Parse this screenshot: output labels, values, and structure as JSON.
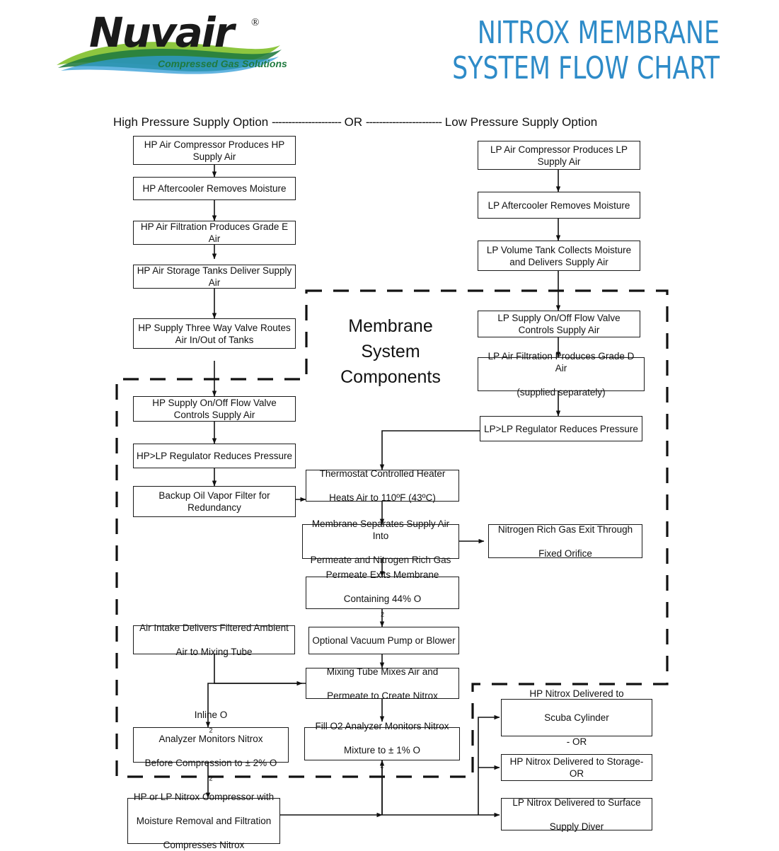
{
  "logo": {
    "brand": "Nuvair",
    "registered": "®",
    "tagline": "Compressed Gas Solutions",
    "brand_color": "#1a1a1a",
    "tagline_color": "#1f7a3f"
  },
  "title": {
    "line1": "NITROX MEMBRANE",
    "line2": "SYSTEM FLOW CHART",
    "color": "#2E8BC8"
  },
  "options_header": {
    "left": "High Pressure Supply Option",
    "dash_left": "---------------------",
    "or": "OR",
    "dash_right": "-----------------------",
    "right": "Low Pressure Supply Option"
  },
  "membrane_group": {
    "label_line1": "Membrane",
    "label_line2": "System",
    "label_line3": "Components"
  },
  "nodes": {
    "hp1": "HP Air Compressor Produces HP Supply Air",
    "hp2": "HP Aftercooler Removes Moisture",
    "hp3": "HP Air Filtration Produces Grade E Air",
    "hp4": "HP Air Storage Tanks Deliver Supply Air",
    "hp5": "HP Supply Three Way Valve Routes Air In/Out of Tanks",
    "hp6": "HP Supply On/Off Flow Valve Controls Supply Air",
    "hp7": "HP>LP Regulator Reduces Pressure",
    "hp8": "Backup Oil Vapor Filter for Redundancy",
    "lp1": "LP Air Compressor Produces LP Supply Air",
    "lp2": "LP Aftercooler Removes Moisture",
    "lp3": "LP Volume Tank Collects Moisture and Delivers Supply Air",
    "lp4": "LP Supply On/Off Flow Valve Controls Supply Air",
    "lp5_line1": "LP Air Filtration Produces Grade D Air",
    "lp5_line2": "(supplied separately)",
    "lp6": "LP>LP Regulator Reduces Pressure",
    "heater_line1": "Thermostat Controlled Heater",
    "heater_line2": "Heats Air to 110ºF (43ºC)",
    "membrane_line1": "Membrane Separates Supply Air Into",
    "membrane_line2": "Permeate and Nitrogen Rich Gas",
    "nitrogen_exit_line1": "Nitrogen Rich Gas Exit Through",
    "nitrogen_exit_line2": "Fixed Orifice",
    "permeate_line1": "Permeate Exits Membrane",
    "permeate_line2_pre": "Containing 44% O",
    "permeate_line2_sub": "2",
    "vacuum": "Optional Vacuum Pump or Blower",
    "air_intake_line1": "Air Intake Delivers Filtered Ambient",
    "air_intake_line2": "Air to Mixing Tube",
    "mixing_line1": "Mixing Tube Mixes Air and",
    "mixing_line2": "Permeate to Create Nitrox",
    "inline_line1_pre": "Inline O",
    "inline_line1_sub": "2",
    "inline_line1_post": " Analyzer Monitors Nitrox",
    "inline_line2_pre": "Before Compression to ± 2% O",
    "inline_line2_sub": "2",
    "fill_line1": "Fill O2 Analyzer Monitors Nitrox",
    "fill_line2_pre": "Mixture to ± 1% O",
    "fill_line2_sub": "2",
    "compressor_line1": "HP or LP Nitrox Compressor with",
    "compressor_line2": "Moisture Removal and Filtration",
    "compressor_line3": "Compresses Nitrox",
    "out1_line1": "HP Nitrox Delivered to",
    "out1_line2": "Scuba Cylinder",
    "out1_line3": "- OR",
    "out2": "HP Nitrox Delivered to Storage-OR",
    "out3_line1": "LP Nitrox Delivered to Surface",
    "out3_line2": "Supply Diver"
  }
}
